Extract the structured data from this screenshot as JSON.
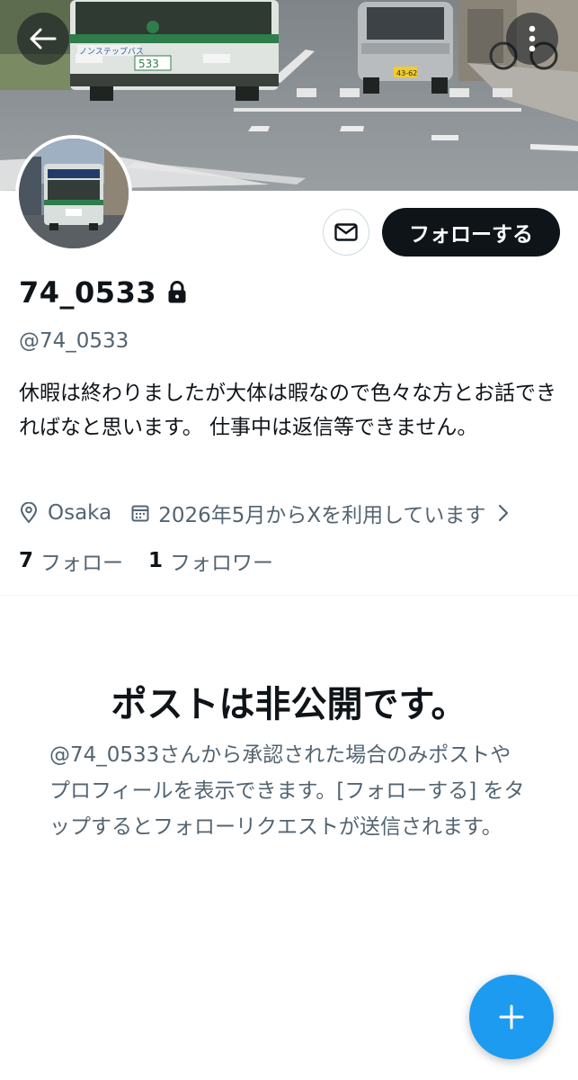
{
  "profile": {
    "display_name": "74_0533",
    "handle": "@74_0533",
    "bio": "休暇は終わりましたが大体は暇なので色々な方とお話できればなと思います。 仕事中は返信等できません。",
    "location": "Osaka",
    "joined": "2026年5月からXを利用しています",
    "following_count": "7",
    "following_label": "フォロー",
    "followers_count": "1",
    "followers_label": "フォロワー"
  },
  "actions": {
    "follow_label": "フォローする"
  },
  "private_notice": {
    "title": "ポストは非公開です。",
    "body": "@74_0533さんから承認された場合のみポストやプロフィールを表示できます。[フォローする] をタップするとフォローリクエストが送信されます。"
  },
  "banner": {
    "bus_route_sign": "ノンステップバス",
    "bus_plate": "533",
    "car_plate": "43-62"
  },
  "icons": {
    "back": "arrow-left-icon",
    "more": "more-vertical-icon",
    "message": "envelope-icon",
    "lock": "lock-icon",
    "location": "location-pin-icon",
    "calendar": "calendar-icon",
    "chevron": "chevron-right-icon",
    "compose": "plus-icon"
  },
  "colors": {
    "accent": "#1d9bf0",
    "text_primary": "#0f1419",
    "text_secondary": "#536471",
    "follow_button_bg": "#0f1419"
  }
}
